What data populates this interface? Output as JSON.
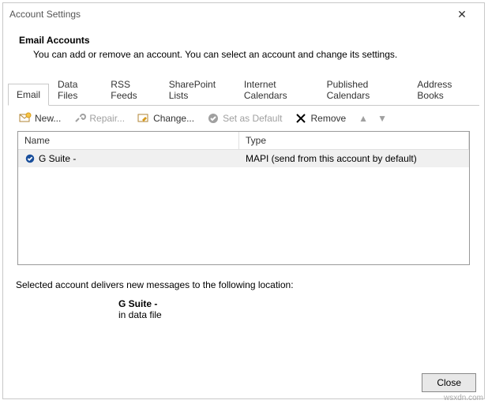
{
  "window": {
    "title": "Account Settings",
    "heading": "Email Accounts",
    "subheading": "You can add or remove an account. You can select an account and change its settings."
  },
  "tabs": [
    "Email",
    "Data Files",
    "RSS Feeds",
    "SharePoint Lists",
    "Internet Calendars",
    "Published Calendars",
    "Address Books"
  ],
  "active_tab_index": 0,
  "toolbar": {
    "new": "New...",
    "repair": "Repair...",
    "change": "Change...",
    "set_default": "Set as Default",
    "remove": "Remove"
  },
  "columns": {
    "name": "Name",
    "type": "Type"
  },
  "accounts": [
    {
      "name": "G Suite -",
      "type": "MAPI (send from this account by default)",
      "default": true
    }
  ],
  "delivery": {
    "intro": "Selected account delivers new messages to the following location:",
    "name": "G Suite -",
    "location": "in data file"
  },
  "buttons": {
    "close": "Close"
  },
  "watermark": "wsxdn.com"
}
